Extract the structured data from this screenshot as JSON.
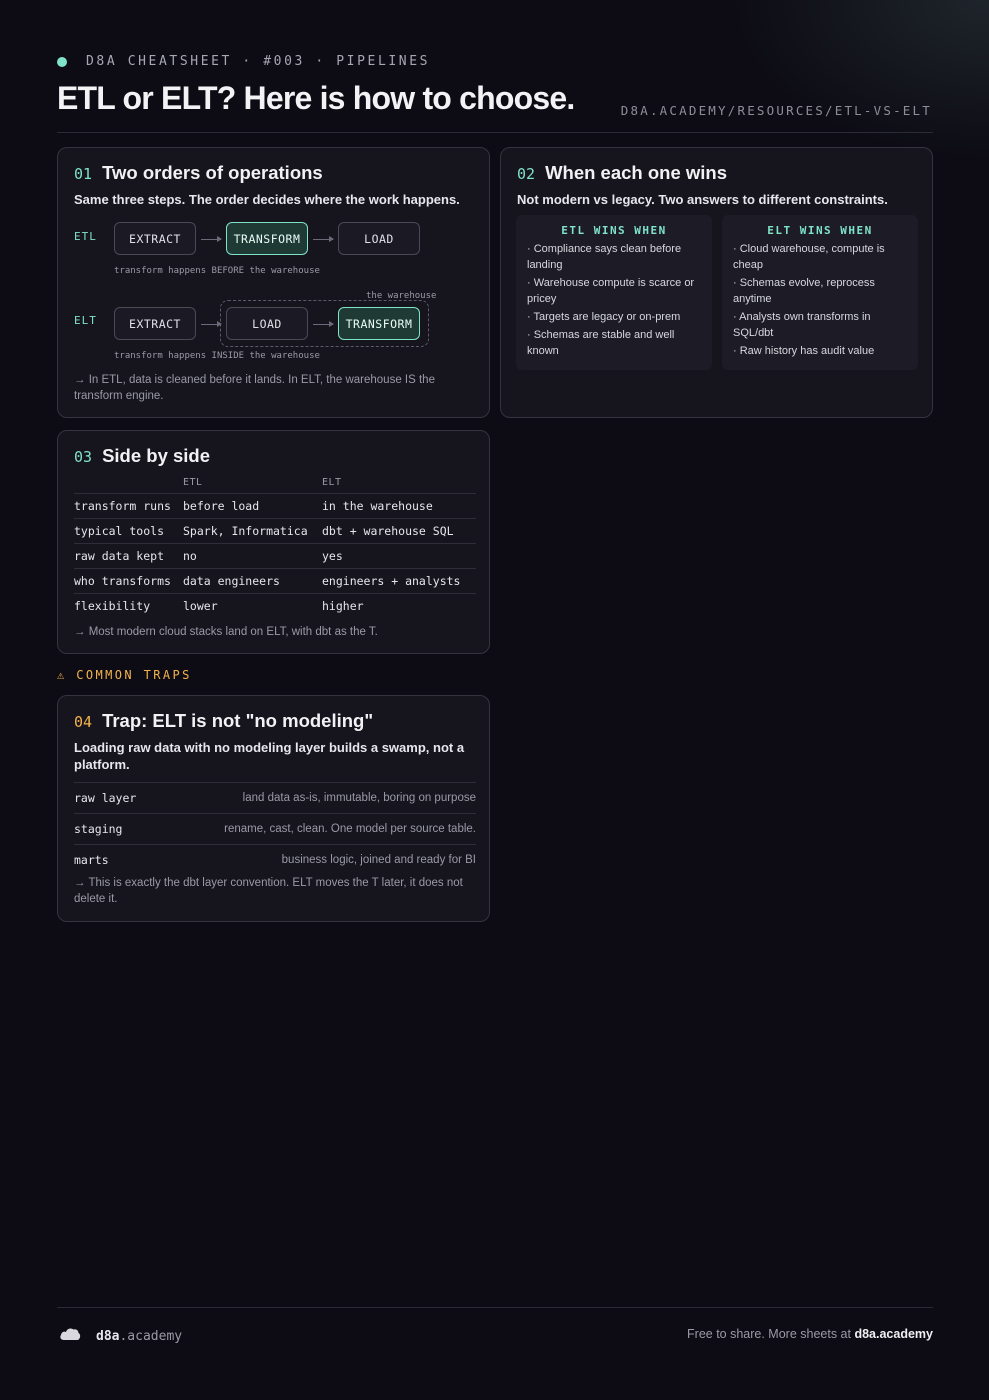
{
  "header": {
    "eyebrow": "D8A CHEATSHEET · #003 · PIPELINES",
    "title": "ETL or ELT? Here is how to choose.",
    "url": "D8A.ACADEMY/RESOURCES/ETL-VS-ELT"
  },
  "card1": {
    "num": "01",
    "title": "Two orders of operations",
    "lead": "Same three steps. The order decides where the work happens.",
    "etl": {
      "label": "ETL",
      "steps": [
        "EXTRACT",
        "TRANSFORM",
        "LOAD"
      ],
      "caption": "transform happens BEFORE the warehouse"
    },
    "elt": {
      "label": "ELT",
      "steps": [
        "EXTRACT",
        "LOAD",
        "TRANSFORM"
      ],
      "caption": "transform happens INSIDE the warehouse",
      "warehouse_label": "the warehouse"
    },
    "note": "→ In ETL, data is cleaned before it lands. In ELT, the warehouse IS the transform engine."
  },
  "card2": {
    "num": "02",
    "title": "When each one wins",
    "lead": "Not modern vs legacy. Two answers to different constraints.",
    "etl_col": {
      "heading": "ETL WINS WHEN",
      "items": [
        "· Compliance says clean before landing",
        "· Warehouse compute is scarce or pricey",
        "· Targets are legacy or on-prem",
        "· Schemas are stable and well known"
      ]
    },
    "elt_col": {
      "heading": "ELT WINS WHEN",
      "items": [
        "· Cloud warehouse, compute is cheap",
        "· Schemas evolve, reprocess anytime",
        "· Analysts own transforms in SQL/dbt",
        "· Raw history has audit value"
      ]
    }
  },
  "card3": {
    "num": "03",
    "title": "Side by side",
    "columns": [
      "",
      "ETL",
      "ELT"
    ],
    "rows": [
      [
        "transform runs",
        "before load",
        "in the warehouse"
      ],
      [
        "typical tools",
        "Spark, Informatica",
        "dbt + warehouse SQL"
      ],
      [
        "raw data kept",
        "no",
        "yes"
      ],
      [
        "who transforms",
        "data engineers",
        "engineers + analysts"
      ],
      [
        "flexibility",
        "lower",
        "higher"
      ]
    ],
    "note": "→ Most modern cloud stacks land on ELT, with dbt as the T."
  },
  "traps": {
    "label": "⚠ COMMON TRAPS"
  },
  "card4": {
    "num": "04",
    "title": "Trap: ELT is not \"no modeling\"",
    "lead": "Loading raw data with no modeling layer builds a swamp, not a platform.",
    "layers": [
      {
        "name": "raw layer",
        "desc": "land data as-is, immutable, boring on purpose"
      },
      {
        "name": "staging",
        "desc": "rename, cast, clean. One model per source table."
      },
      {
        "name": "marts",
        "desc": "business logic, joined and ready for BI"
      }
    ],
    "note": "→ This is exactly the dbt layer convention. ELT moves the T later, it does not delete it."
  },
  "footer": {
    "brand_bold": "d8a",
    "brand_rest": ".academy",
    "share_text": "Free to share. More sheets at ",
    "share_link": "d8a.academy"
  },
  "colors": {
    "accent": "#7fe3c7",
    "warning": "#f2b24d",
    "background": "#0d0c14",
    "card": "#16151e"
  },
  "icons": {
    "status_dot": "dot-icon",
    "footer_logo": "cloud-icon",
    "traps": "warning-icon"
  }
}
